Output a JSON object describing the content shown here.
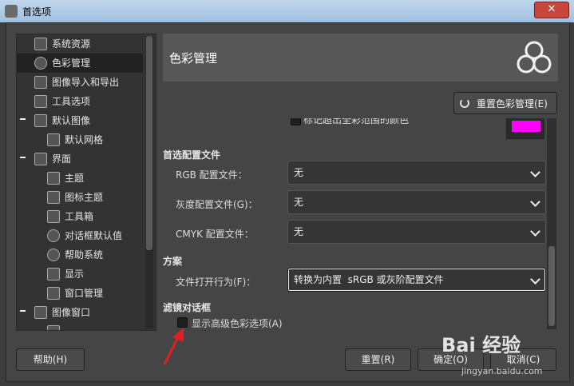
{
  "window": {
    "title": "首选项",
    "close": "✕"
  },
  "sidebar": {
    "items": [
      {
        "label": "系统资源",
        "icon": "chip-icon"
      },
      {
        "label": "色彩管理",
        "icon": "color-circles-icon"
      },
      {
        "label": "图像导入和导出",
        "icon": "image-import-icon"
      },
      {
        "label": "工具选项",
        "icon": "tool-options-icon"
      },
      {
        "label": "默认图像",
        "icon": "default-image-icon"
      },
      {
        "label": "默认网格",
        "icon": "grid-icon"
      },
      {
        "label": "界面",
        "icon": "interface-icon"
      },
      {
        "label": "主题",
        "icon": "theme-icon"
      },
      {
        "label": "图标主题",
        "icon": "icon-theme-icon"
      },
      {
        "label": "工具箱",
        "icon": "toolbox-icon"
      },
      {
        "label": "对话框默认值",
        "icon": "dialog-defaults-icon"
      },
      {
        "label": "帮助系统",
        "icon": "help-system-icon"
      },
      {
        "label": "显示",
        "icon": "display-icon"
      },
      {
        "label": "窗口管理",
        "icon": "window-management-icon"
      },
      {
        "label": "图像窗口",
        "icon": "image-window-icon"
      }
    ]
  },
  "header": {
    "title": "色彩管理",
    "logo": "color-management-logo"
  },
  "reset_button": "重置色彩管理(E)",
  "content": {
    "partial_top": "标记超出全彩范围的颜色",
    "preferred_profiles": {
      "title": "首选配置文件",
      "rgb_label": "RGB 配置文件：",
      "rgb_value": "无",
      "gray_label": "灰度配置文件(G)：",
      "gray_value": "无",
      "cmyk_label": "CMYK 配置文件：",
      "cmyk_value": "无"
    },
    "policy": {
      "title": "方案",
      "open_label": "文件打开行为(F)：",
      "open_value": "转换为内置  sRGB 或灰阶配置文件"
    },
    "filter_dialogs": {
      "title": "滤镜对话框",
      "advanced_label": "显示高级色彩选项(A)"
    }
  },
  "buttons": {
    "help": "帮助(H)",
    "reset": "重置(R)",
    "ok": "确定(O)",
    "cancel": "取消(C)"
  },
  "watermark": {
    "brand": "Bai 经验",
    "url": "jingyan.baidu.com"
  },
  "colors": {
    "out_of_gamut": "#ff00ff",
    "annotation_arrow": "#e02020"
  }
}
